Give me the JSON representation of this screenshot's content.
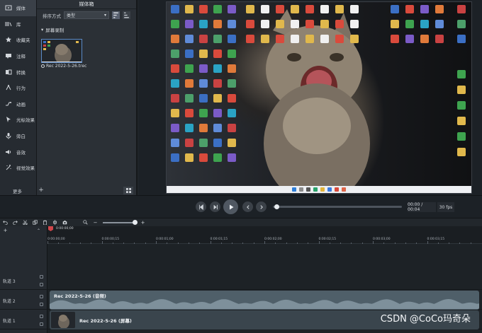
{
  "sidebar": {
    "items": [
      {
        "label": "媒体",
        "icon": "media-icon"
      },
      {
        "label": "库",
        "icon": "library-icon"
      },
      {
        "label": "收藏夹",
        "icon": "star-icon"
      },
      {
        "label": "注释",
        "icon": "annotation-icon"
      },
      {
        "label": "转换",
        "icon": "transition-icon"
      },
      {
        "label": "行为",
        "icon": "behavior-icon"
      },
      {
        "label": "动画",
        "icon": "animation-icon"
      },
      {
        "label": "光标效果",
        "icon": "cursor-icon"
      },
      {
        "label": "旁白",
        "icon": "microphone-icon"
      },
      {
        "label": "音效",
        "icon": "audio-icon"
      },
      {
        "label": "视觉效果",
        "icon": "visual-effects-icon"
      }
    ],
    "more_label": "更多"
  },
  "media_bin": {
    "title": "媒体箱",
    "sort_label": "排序方式",
    "sort_value": "类型",
    "group_label": "屏幕录制",
    "item_label": "Rec 2022-5-26.trec"
  },
  "playback": {
    "time": "00:00 / 00:04",
    "fps": "30 fps"
  },
  "timeline": {
    "playhead_time": "0:00:00;00",
    "ticks": [
      "0:00:00;00",
      "0:00:00;15",
      "0:00:01;00",
      "0:00:01;15",
      "0:00:02;00",
      "0:00:02;15",
      "0:00:03;00",
      "0:00:03;15"
    ],
    "tracks": [
      {
        "label": "轨道 3",
        "clip": null
      },
      {
        "label": "轨道 2",
        "clip": "Rec 2022-5-26 (音频)"
      },
      {
        "label": "轨道 1",
        "clip": "Rec 2022-5-26 (屏幕)"
      }
    ]
  },
  "watermark": "CSDN @CoCo玛奇朵",
  "colors": {
    "accent": "#5b8ac7",
    "playhead": "#d0464a",
    "audio_clip": "#4f5f69"
  }
}
